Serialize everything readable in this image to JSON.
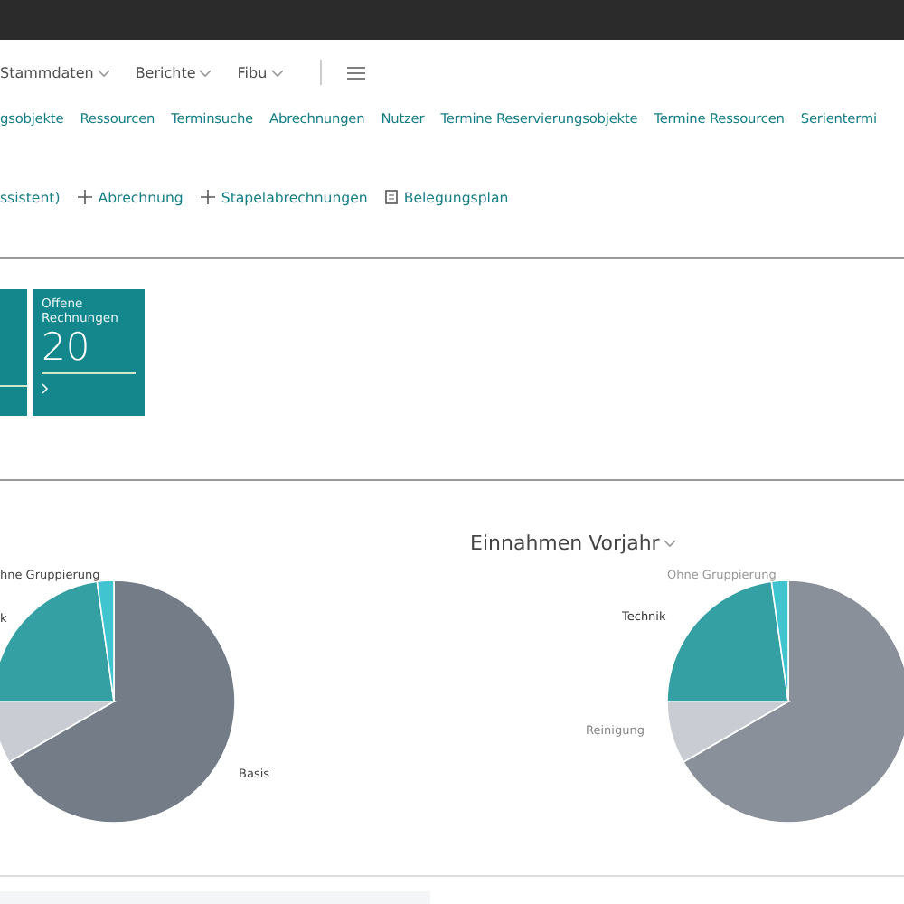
{
  "top_menu": [
    {
      "label": "Stammdaten"
    },
    {
      "label": "Berichte"
    },
    {
      "label": "Fibu"
    }
  ],
  "nav_links": [
    "gsobjekte",
    "Ressourcen",
    "Terminsuche",
    "Abrechnungen",
    "Nutzer",
    "Termine Reservierungsobjekte",
    "Termine Ressourcen",
    "Serientermi"
  ],
  "actions": [
    {
      "label": "ssistent)",
      "kind": "text"
    },
    {
      "label": "Abrechnung",
      "kind": "add"
    },
    {
      "label": "Stapelabrechnungen",
      "kind": "add"
    },
    {
      "label": "Belegungsplan",
      "kind": "doc"
    }
  ],
  "tiles": [
    {
      "kind": "partial"
    },
    {
      "kind": "full",
      "label": "Offene Rechnungen",
      "value": "20"
    }
  ],
  "charts": [
    {
      "slices": [
        {
          "label": "Basis",
          "color": "#737c87"
        },
        {
          "color": "#c9cdd3"
        },
        {
          "label": "k",
          "color": "#34a0a4"
        },
        {
          "label": "hne Gruppierung",
          "color": "#40c4d0"
        }
      ]
    },
    {
      "title": "Einnahmen Vorjahr",
      "slices": [
        {
          "color": "#8a9099"
        },
        {
          "label": "Reinigung",
          "color": "#c9cdd3"
        },
        {
          "label": "Technik",
          "color": "#34a0a4"
        },
        {
          "label": "Ohne Gruppierung",
          "color": "#40c4d0"
        }
      ]
    }
  ]
}
